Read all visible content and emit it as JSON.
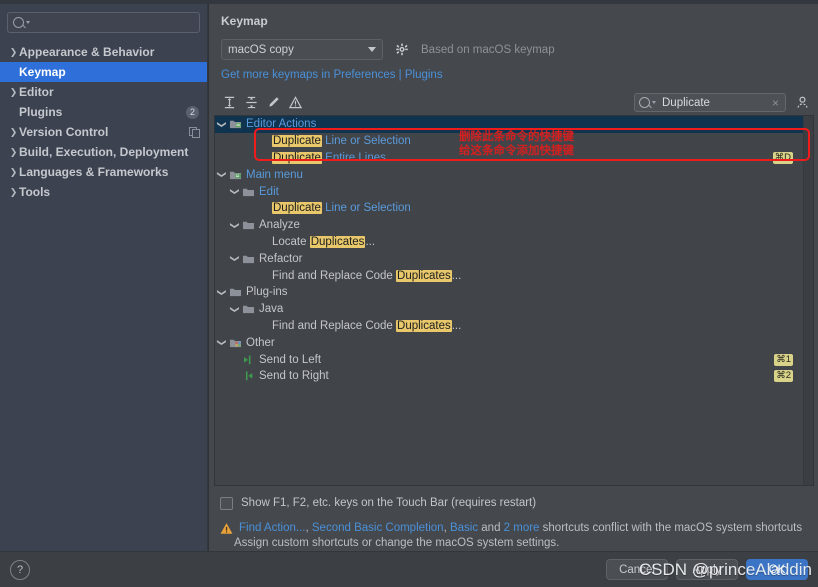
{
  "sidebar": {
    "search": {
      "value": "",
      "placeholder": ""
    },
    "items": [
      {
        "label": "Appearance & Behavior",
        "chevron": "›",
        "selected": false,
        "badge": "",
        "icon": ""
      },
      {
        "label": "Keymap",
        "chevron": "",
        "selected": true,
        "badge": "",
        "icon": ""
      },
      {
        "label": "Editor",
        "chevron": "›",
        "selected": false,
        "badge": "",
        "icon": ""
      },
      {
        "label": "Plugins",
        "chevron": "",
        "selected": false,
        "badge": "2",
        "icon": ""
      },
      {
        "label": "Version Control",
        "chevron": "›",
        "selected": false,
        "badge": "",
        "icon": "copy-icon"
      },
      {
        "label": "Build, Execution, Deployment",
        "chevron": "›",
        "selected": false,
        "badge": "",
        "icon": ""
      },
      {
        "label": "Languages & Frameworks",
        "chevron": "›",
        "selected": false,
        "badge": "",
        "icon": ""
      },
      {
        "label": "Tools",
        "chevron": "›",
        "selected": false,
        "badge": "",
        "icon": ""
      }
    ]
  },
  "main": {
    "title": "Keymap",
    "keymap_select": "macOS copy",
    "based_on": "Based on macOS keymap",
    "get_more_link": "Get more keymaps in Preferences | Plugins",
    "toolbar": {
      "expand_all": "expand-all-icon",
      "collapse_all": "collapse-all-icon",
      "edit": "edit-pencil-icon",
      "conflicts": "warning-icon",
      "find_value": "Duplicate",
      "find_clear": "×",
      "person": "person-icon"
    },
    "tree": [
      {
        "indent": 0,
        "chevron": "⌄",
        "icon": "editor-actions-icon",
        "selected": true,
        "parts": [
          {
            "t": "Editor Actions",
            "hl": false,
            "blue": true
          }
        ],
        "shortcut": ""
      },
      {
        "indent": 2,
        "chevron": "",
        "icon": "",
        "selected": false,
        "parts": [
          {
            "t": "Duplicate",
            "hl": true,
            "blue": false
          },
          {
            "t": " Line or Selection",
            "hl": false,
            "blue": true
          }
        ],
        "shortcut": ""
      },
      {
        "indent": 2,
        "chevron": "",
        "icon": "",
        "selected": false,
        "parts": [
          {
            "t": "Duplicate",
            "hl": true,
            "blue": false
          },
          {
            "t": " Entire Lines",
            "hl": false,
            "blue": true
          }
        ],
        "shortcut": "⌘D"
      },
      {
        "indent": 0,
        "chevron": "⌄",
        "icon": "main-menu-icon",
        "selected": false,
        "parts": [
          {
            "t": "Main menu",
            "hl": false,
            "blue": true
          }
        ],
        "shortcut": ""
      },
      {
        "indent": 1,
        "chevron": "⌄",
        "icon": "folder-icon",
        "selected": false,
        "parts": [
          {
            "t": "Edit",
            "hl": false,
            "blue": true
          }
        ],
        "shortcut": ""
      },
      {
        "indent": 2,
        "chevron": "",
        "icon": "",
        "selected": false,
        "parts": [
          {
            "t": "Duplicate",
            "hl": true,
            "blue": false
          },
          {
            "t": " Line or Selection",
            "hl": false,
            "blue": true
          }
        ],
        "shortcut": ""
      },
      {
        "indent": 1,
        "chevron": "⌄",
        "icon": "folder-icon",
        "selected": false,
        "parts": [
          {
            "t": "Analyze",
            "hl": false,
            "blue": false
          }
        ],
        "shortcut": ""
      },
      {
        "indent": 2,
        "chevron": "",
        "icon": "",
        "selected": false,
        "parts": [
          {
            "t": "Locate ",
            "hl": false,
            "blue": false
          },
          {
            "t": "Duplicates",
            "hl": true,
            "blue": false
          },
          {
            "t": "...",
            "hl": false,
            "blue": false
          }
        ],
        "shortcut": ""
      },
      {
        "indent": 1,
        "chevron": "⌄",
        "icon": "folder-icon",
        "selected": false,
        "parts": [
          {
            "t": "Refactor",
            "hl": false,
            "blue": false
          }
        ],
        "shortcut": ""
      },
      {
        "indent": 2,
        "chevron": "",
        "icon": "",
        "selected": false,
        "parts": [
          {
            "t": "Find and Replace Code ",
            "hl": false,
            "blue": false
          },
          {
            "t": "Duplicates",
            "hl": true,
            "blue": false
          },
          {
            "t": "...",
            "hl": false,
            "blue": false
          }
        ],
        "shortcut": ""
      },
      {
        "indent": 0,
        "chevron": "⌄",
        "icon": "folder-icon",
        "selected": false,
        "parts": [
          {
            "t": "Plug-ins",
            "hl": false,
            "blue": false
          }
        ],
        "shortcut": ""
      },
      {
        "indent": 1,
        "chevron": "⌄",
        "icon": "folder-icon",
        "selected": false,
        "parts": [
          {
            "t": "Java",
            "hl": false,
            "blue": false
          }
        ],
        "shortcut": ""
      },
      {
        "indent": 2,
        "chevron": "",
        "icon": "",
        "selected": false,
        "parts": [
          {
            "t": "Find and Replace Code ",
            "hl": false,
            "blue": false
          },
          {
            "t": "Duplicates",
            "hl": true,
            "blue": false
          },
          {
            "t": "...",
            "hl": false,
            "blue": false
          }
        ],
        "shortcut": ""
      },
      {
        "indent": 0,
        "chevron": "⌄",
        "icon": "other-icon",
        "selected": false,
        "parts": [
          {
            "t": "Other",
            "hl": false,
            "blue": false
          }
        ],
        "shortcut": ""
      },
      {
        "indent": 1,
        "chevron": "",
        "icon": "send-left-icon",
        "selected": false,
        "parts": [
          {
            "t": "Send to Left",
            "hl": false,
            "blue": false
          }
        ],
        "shortcut": "⌘1"
      },
      {
        "indent": 1,
        "chevron": "",
        "icon": "send-right-icon",
        "selected": false,
        "parts": [
          {
            "t": "Send to Right",
            "hl": false,
            "blue": false
          }
        ],
        "shortcut": "⌘2"
      }
    ],
    "annotations": {
      "line1": "删除此条命令的快捷键",
      "line2": "给这条命令添加快捷键",
      "box_color": "#f01c1c",
      "text_color": "#d32020"
    },
    "touchbar_checkbox_label": "Show F1, F2, etc. keys on the Touch Bar (requires restart)",
    "conflict": {
      "links": [
        "Find Action...",
        "Second Basic Completion",
        "Basic",
        "2 more"
      ],
      "line1_prefix": "",
      "mid1": ", ",
      "mid2": ", ",
      "mid3": " and ",
      "line1_suffix": " shortcuts conflict with the macOS system shortcuts",
      "line2": "Assign custom shortcuts or change the macOS system settings."
    }
  },
  "footer": {
    "help": "?",
    "cancel": "Cancel",
    "apply": "Apply",
    "ok": "OK",
    "watermark": "CSDN @princeAladdin"
  },
  "colors": {
    "accent": "#2f6fd9",
    "link": "#4a90d9",
    "highlight": "#e8c86a",
    "tree_selection": "#10344f",
    "sidebar_bg": "#3c4250",
    "tree_bg": "#414448"
  }
}
